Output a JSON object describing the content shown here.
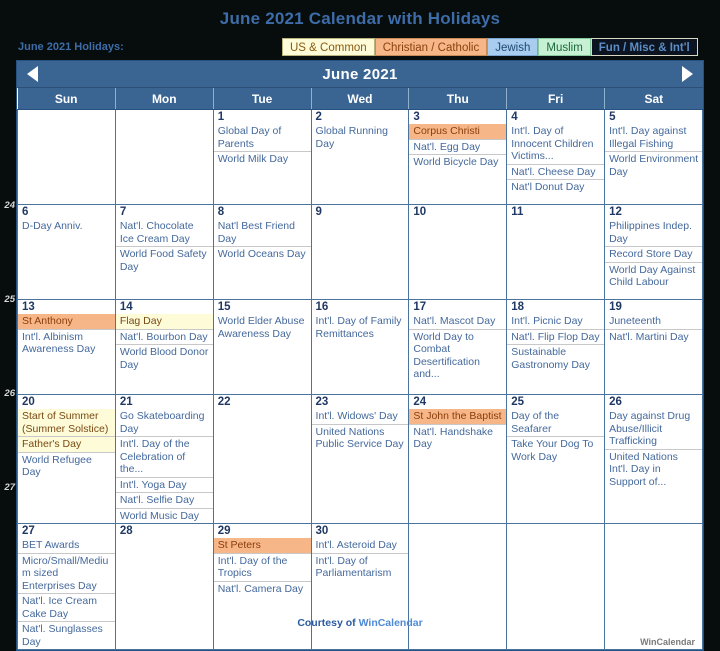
{
  "page": {
    "title": "June 2021 Calendar with Holidays",
    "footer_prefix": "Courtesy of ",
    "footer_brand": "WinCalendar",
    "watermark": "WinCalendar"
  },
  "legend": {
    "label": "June 2021 Holidays:",
    "chips": [
      {
        "label": "US & Common",
        "key": "us",
        "color": "#fdfbd8"
      },
      {
        "label": "Christian / Catholic",
        "key": "christian",
        "color": "#f7b687"
      },
      {
        "label": "Jewish",
        "key": "jewish",
        "color": "#a8cdef"
      },
      {
        "label": "Muslim",
        "key": "muslim",
        "color": "#c7f0d4"
      },
      {
        "label": "Fun / Misc & Int'l",
        "key": "fun",
        "color": "#0b1420"
      }
    ]
  },
  "calendar": {
    "month_title": "June 2021",
    "prev_label": "Previous month",
    "next_label": "Next month",
    "weekday_headers": [
      "Sun",
      "Mon",
      "Tue",
      "Wed",
      "Thu",
      "Fri",
      "Sat"
    ],
    "week_numbers": [
      "",
      "24",
      "25",
      "26",
      "27"
    ],
    "weeks": [
      [
        {
          "day": "",
          "empty": true,
          "events": []
        },
        {
          "day": "",
          "empty": true,
          "events": []
        },
        {
          "day": "1",
          "events": [
            {
              "text": "Global Day of Parents",
              "cat": ""
            },
            {
              "text": "World Milk Day",
              "cat": ""
            }
          ]
        },
        {
          "day": "2",
          "events": [
            {
              "text": "Global Running Day",
              "cat": ""
            }
          ]
        },
        {
          "day": "3",
          "events": [
            {
              "text": "Corpus Christi",
              "cat": "christian"
            },
            {
              "text": "Nat'l. Egg Day",
              "cat": ""
            },
            {
              "text": "World Bicycle Day",
              "cat": ""
            }
          ]
        },
        {
          "day": "4",
          "events": [
            {
              "text": "Int'l. Day of Innocent Children Victims...",
              "cat": ""
            },
            {
              "text": "Nat'l. Cheese Day",
              "cat": ""
            },
            {
              "text": "Nat'l Donut Day",
              "cat": ""
            }
          ]
        },
        {
          "day": "5",
          "events": [
            {
              "text": "Int'l. Day against Illegal Fishing",
              "cat": ""
            },
            {
              "text": "World Environment Day",
              "cat": ""
            }
          ]
        }
      ],
      [
        {
          "day": "6",
          "events": [
            {
              "text": "D-Day Anniv.",
              "cat": ""
            }
          ]
        },
        {
          "day": "7",
          "events": [
            {
              "text": "Nat'l. Chocolate Ice Cream Day",
              "cat": ""
            },
            {
              "text": "World Food Safety Day",
              "cat": ""
            }
          ]
        },
        {
          "day": "8",
          "events": [
            {
              "text": "Nat'l Best Friend Day",
              "cat": ""
            },
            {
              "text": "World Oceans Day",
              "cat": ""
            }
          ]
        },
        {
          "day": "9",
          "events": []
        },
        {
          "day": "10",
          "events": []
        },
        {
          "day": "11",
          "events": []
        },
        {
          "day": "12",
          "events": [
            {
              "text": "Philippines Indep. Day",
              "cat": ""
            },
            {
              "text": "Record Store Day",
              "cat": ""
            },
            {
              "text": "World Day Against Child Labour",
              "cat": ""
            }
          ]
        }
      ],
      [
        {
          "day": "13",
          "events": [
            {
              "text": "St Anthony",
              "cat": "christian"
            },
            {
              "text": "Int'l. Albinism Awareness Day",
              "cat": ""
            }
          ]
        },
        {
          "day": "14",
          "events": [
            {
              "text": "Flag Day",
              "cat": "us"
            },
            {
              "text": "Nat'l. Bourbon Day",
              "cat": ""
            },
            {
              "text": "World Blood Donor Day",
              "cat": ""
            }
          ]
        },
        {
          "day": "15",
          "events": [
            {
              "text": "World Elder Abuse Awareness Day",
              "cat": ""
            }
          ]
        },
        {
          "day": "16",
          "events": [
            {
              "text": "Int'l. Day of Family Remittances",
              "cat": ""
            }
          ]
        },
        {
          "day": "17",
          "events": [
            {
              "text": "Nat'l. Mascot Day",
              "cat": ""
            },
            {
              "text": "World Day to Combat Desertification and...",
              "cat": ""
            }
          ]
        },
        {
          "day": "18",
          "events": [
            {
              "text": "Int'l. Picnic Day",
              "cat": ""
            },
            {
              "text": "Nat'l. Flip Flop Day",
              "cat": ""
            },
            {
              "text": "Sustainable Gastronomy Day",
              "cat": ""
            }
          ]
        },
        {
          "day": "19",
          "events": [
            {
              "text": "Juneteenth",
              "cat": ""
            },
            {
              "text": "Nat'l. Martini Day",
              "cat": ""
            }
          ]
        }
      ],
      [
        {
          "day": "20",
          "events": [
            {
              "text": "Start of Summer (Summer Solstice)",
              "cat": "us"
            },
            {
              "text": "Father's Day",
              "cat": "us"
            },
            {
              "text": "World Refugee Day",
              "cat": ""
            }
          ]
        },
        {
          "day": "21",
          "events": [
            {
              "text": "Go Skateboarding Day",
              "cat": ""
            },
            {
              "text": "Int'l. Day of the Celebration of the...",
              "cat": ""
            },
            {
              "text": "Int'l. Yoga Day",
              "cat": ""
            },
            {
              "text": "Nat'l. Selfie Day",
              "cat": ""
            },
            {
              "text": "World Music Day",
              "cat": ""
            }
          ]
        },
        {
          "day": "22",
          "events": []
        },
        {
          "day": "23",
          "events": [
            {
              "text": "Int'l. Widows' Day",
              "cat": ""
            },
            {
              "text": "United Nations Public Service Day",
              "cat": ""
            }
          ]
        },
        {
          "day": "24",
          "events": [
            {
              "text": "St John the Baptist",
              "cat": "christian"
            },
            {
              "text": "Nat'l. Handshake Day",
              "cat": ""
            }
          ]
        },
        {
          "day": "25",
          "events": [
            {
              "text": "Day of the Seafarer",
              "cat": ""
            },
            {
              "text": "Take Your Dog To Work Day",
              "cat": ""
            }
          ]
        },
        {
          "day": "26",
          "events": [
            {
              "text": "Day against Drug Abuse/Illicit Trafficking",
              "cat": ""
            },
            {
              "text": "United Nations Int'l. Day in Support of...",
              "cat": ""
            }
          ]
        }
      ],
      [
        {
          "day": "27",
          "events": [
            {
              "text": "BET Awards",
              "cat": ""
            },
            {
              "text": "Micro/Small/Medium sized Enterprises Day",
              "cat": ""
            },
            {
              "text": "Nat'l. Ice Cream Cake Day",
              "cat": ""
            },
            {
              "text": "Nat'l. Sunglasses Day",
              "cat": ""
            }
          ]
        },
        {
          "day": "28",
          "events": []
        },
        {
          "day": "29",
          "events": [
            {
              "text": "St Peters",
              "cat": "christian"
            },
            {
              "text": "Int'l. Day of the Tropics",
              "cat": ""
            },
            {
              "text": "Nat'l. Camera Day",
              "cat": ""
            }
          ]
        },
        {
          "day": "30",
          "events": [
            {
              "text": "Int'l. Asteroid Day",
              "cat": ""
            },
            {
              "text": "Int'l. Day of Parliamentarism",
              "cat": ""
            }
          ]
        },
        {
          "day": "",
          "empty": true,
          "events": []
        },
        {
          "day": "",
          "empty": true,
          "events": []
        },
        {
          "day": "",
          "empty": true,
          "events": []
        }
      ]
    ]
  }
}
